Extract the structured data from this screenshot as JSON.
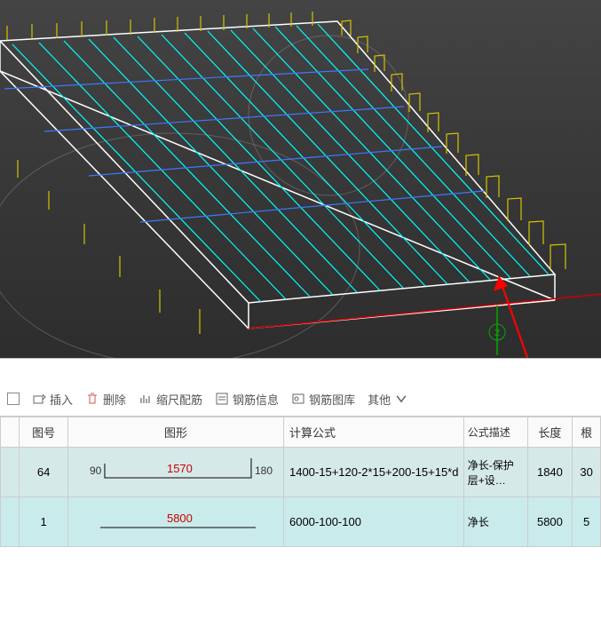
{
  "viewport": {
    "axis_label": "2"
  },
  "toolbar": {
    "insert": "插入",
    "delete": "删除",
    "scale": "缩尺配筋",
    "info": "钢筋信息",
    "library": "钢筋图库",
    "other": "其他"
  },
  "headers": {
    "idx": "",
    "diagram": "图号",
    "shape": "图形",
    "formula": "计算公式",
    "desc": "公式描述",
    "length": "长度",
    "last": "根"
  },
  "rows": [
    {
      "diagram": "64",
      "shape_left": "90",
      "shape_mid": "1570",
      "shape_right": "180",
      "formula": "1400-15+120-2*15+200-15+15*d",
      "desc": "净长-保护层+设…",
      "length": "1840",
      "count": "30"
    },
    {
      "diagram": "1",
      "shape_left": "",
      "shape_mid": "5800",
      "shape_right": "",
      "formula": "6000-100-100",
      "desc": "净长",
      "length": "5800",
      "count": "5"
    }
  ]
}
